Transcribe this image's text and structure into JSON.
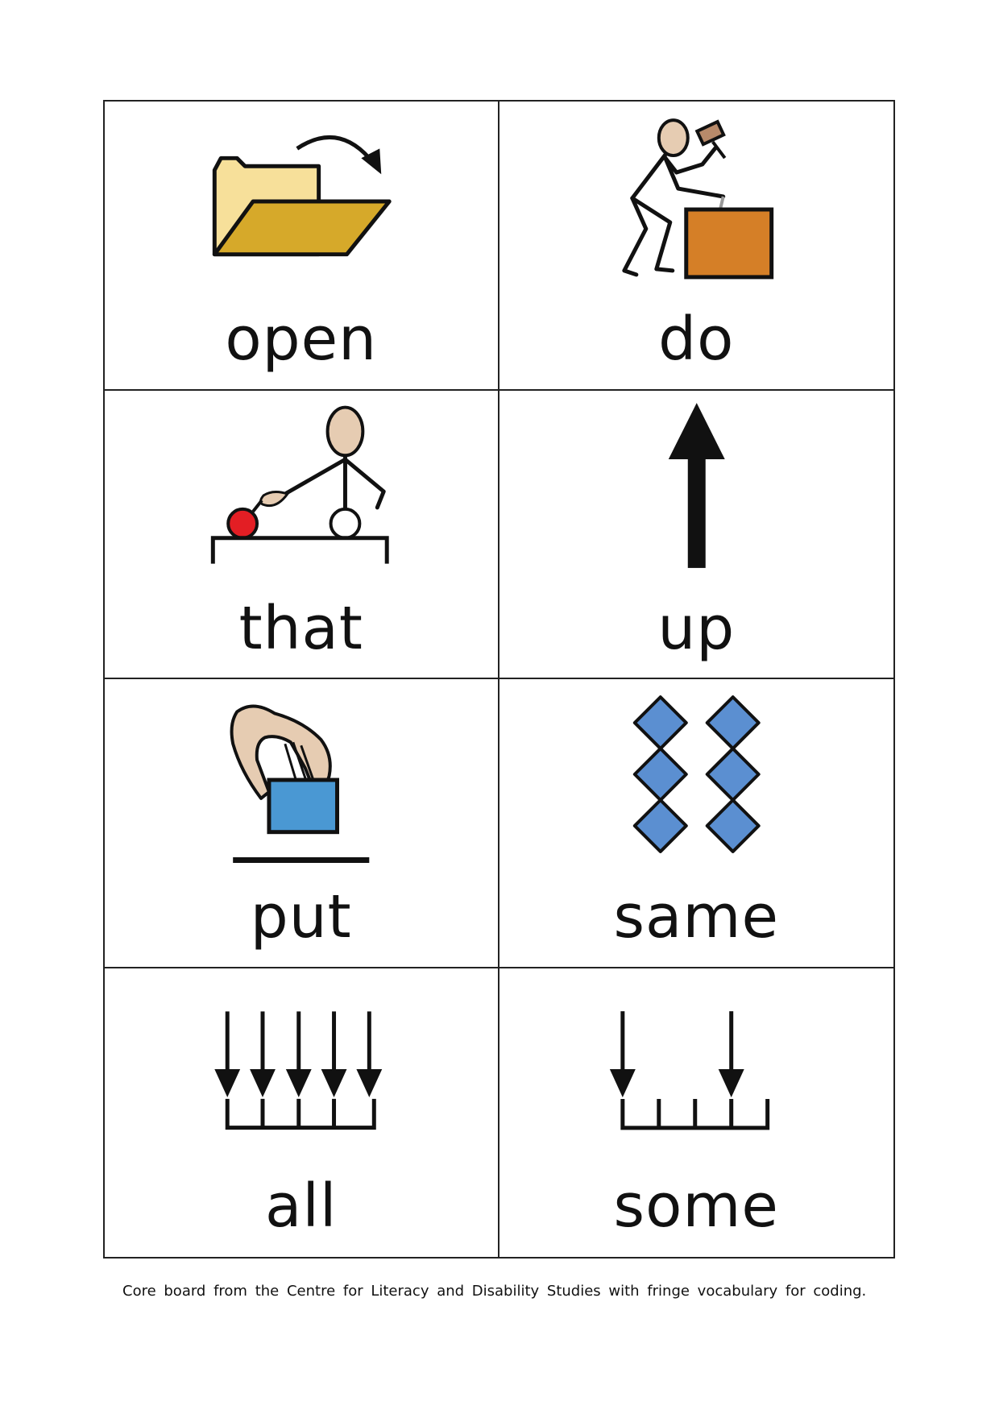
{
  "board": {
    "cells": [
      {
        "word": "open",
        "symbol": "open-folder-icon"
      },
      {
        "word": "do",
        "symbol": "person-hammering-icon"
      },
      {
        "word": "that",
        "symbol": "person-pointing-icon"
      },
      {
        "word": "up",
        "symbol": "up-arrow-icon"
      },
      {
        "word": "put",
        "symbol": "hand-placing-block-icon"
      },
      {
        "word": "same",
        "symbol": "matching-diamonds-icon"
      },
      {
        "word": "all",
        "symbol": "all-arrows-icon"
      },
      {
        "word": "some",
        "symbol": "some-arrows-icon"
      }
    ]
  },
  "caption": "Core board from the Centre for Literacy and Disability Studies with fringe vocabulary for coding.",
  "colors": {
    "folder_back": "#f7e09a",
    "folder_front": "#d6a92a",
    "box_orange": "#d57f27",
    "skin": "#e6ccb2",
    "ball_red": "#e31e24",
    "block_blue": "#4a98d3",
    "diamond_blue": "#5b8fd1",
    "ink": "#111111"
  }
}
